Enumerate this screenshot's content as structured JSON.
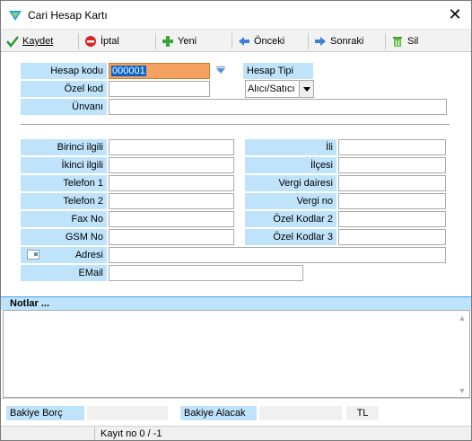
{
  "window": {
    "title": "Cari Hesap Kartı"
  },
  "toolbar": {
    "save": "Kaydet",
    "cancel": "İptal",
    "new": "Yeni",
    "prev": "Önceki",
    "next": "Sonraki",
    "delete": "Sil"
  },
  "form": {
    "hesap_kodu_label": "Hesap kodu",
    "hesap_kodu_value": "000001",
    "hesap_tipi_label": "Hesap Tipi",
    "hesap_tipi_value": "Alıcı/Satıcı",
    "ozel_kod_label": "Özel kod",
    "unvani_label": "Ünvanı",
    "birinci_ilgili_label": "Birinci ilgili",
    "ikinci_ilgili_label": "İkinci ilgili",
    "telefon1_label": "Telefon 1",
    "telefon2_label": "Telefon 2",
    "fax_label": "Fax No",
    "gsm_label": "GSM No",
    "adresi_label": "Adresi",
    "email_label": "EMail",
    "ili_label": "İli",
    "ilcesi_label": "İlçesi",
    "vergi_dairesi_label": "Vergi dairesi",
    "vergi_no_label": "Vergi no",
    "ozel_kodlar2_label": "Özel Kodlar 2",
    "ozel_kodlar3_label": "Özel Kodlar 3"
  },
  "notes": {
    "header": "Notlar ..."
  },
  "balance": {
    "borc_label": "Bakiye Borç",
    "alacak_label": "Bakiye Alacak",
    "currency": "TL"
  },
  "status": {
    "record": "Kayıt no 0 / -1"
  },
  "colors": {
    "label_bg": "#bfe3fb",
    "selected_input": "#f4a261"
  }
}
